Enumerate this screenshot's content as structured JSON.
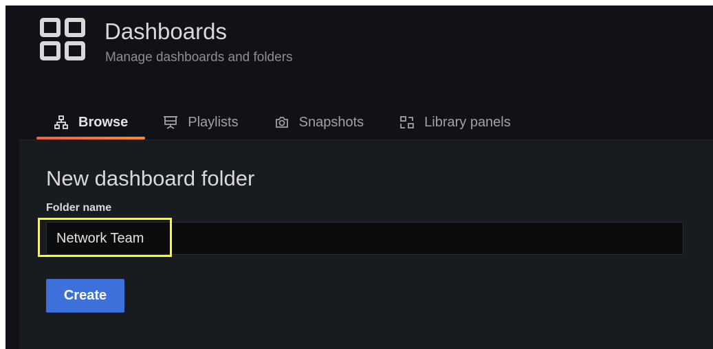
{
  "header": {
    "title": "Dashboards",
    "subtitle": "Manage dashboards and folders",
    "icon": "dashboards-grid-icon"
  },
  "tabs": [
    {
      "label": "Browse",
      "icon": "sitemap-icon",
      "active": true
    },
    {
      "label": "Playlists",
      "icon": "presentation-icon",
      "active": false
    },
    {
      "label": "Snapshots",
      "icon": "camera-icon",
      "active": false
    },
    {
      "label": "Library panels",
      "icon": "library-panel-icon",
      "active": false
    }
  ],
  "form": {
    "heading": "New dashboard folder",
    "folder_label": "Folder name",
    "folder_value": "Network Team",
    "create_label": "Create"
  },
  "colors": {
    "background": "#111217",
    "panel": "#181b1f",
    "primary": "#3d71d9",
    "tab_underline": "#f55f3e",
    "highlight": "#ffff00"
  }
}
